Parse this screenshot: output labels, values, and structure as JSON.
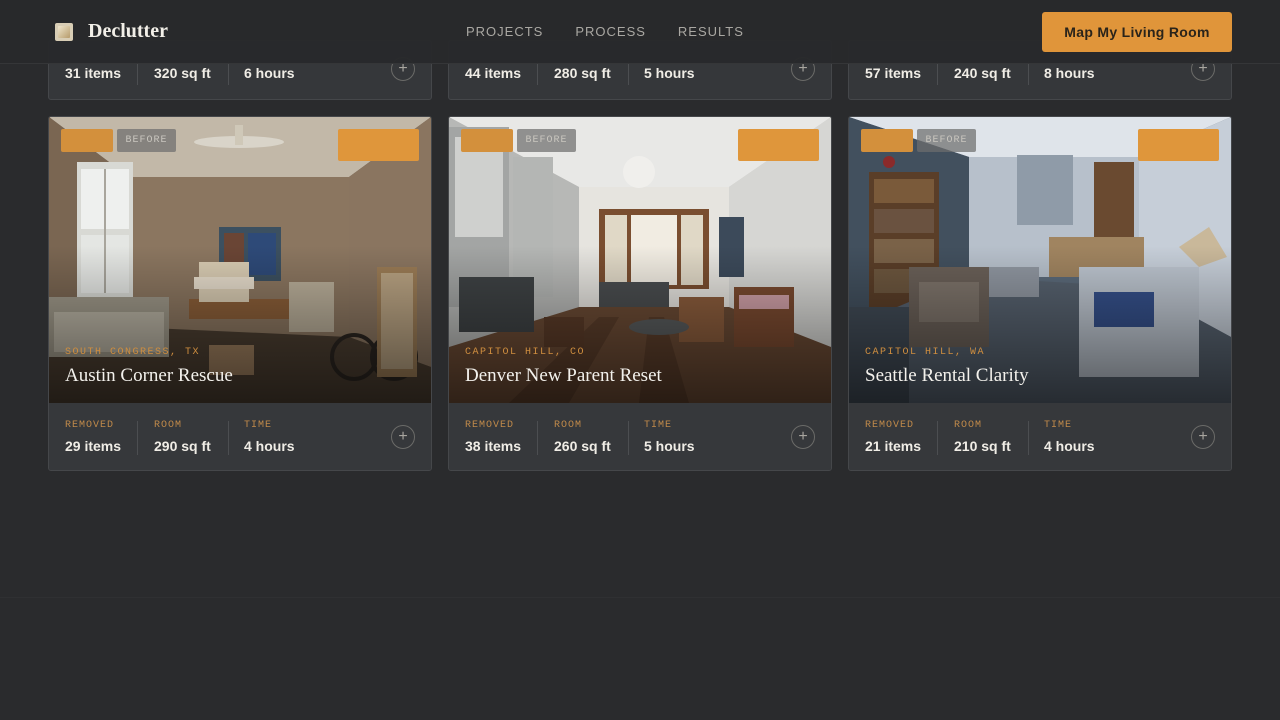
{
  "header": {
    "brand": "Declutter",
    "nav": [
      "PROJECTS",
      "PROCESS",
      "RESULTS"
    ],
    "cta_label": "Map My Living Room"
  },
  "top_cards": [
    {
      "removed": "31 items",
      "room": "320 sq ft",
      "time": "6 hours"
    },
    {
      "removed": "44 items",
      "room": "280 sq ft",
      "time": "5 hours"
    },
    {
      "removed": "57 items",
      "room": "240 sq ft",
      "time": "8 hours"
    }
  ],
  "cards": [
    {
      "badge": "BEFORE",
      "location": "SOUTH CONGRESS, TX",
      "title": "Austin Corner Rescue",
      "stat_labels": [
        "REMOVED",
        "ROOM",
        "TIME"
      ],
      "removed": "29 items",
      "room": "290 sq ft",
      "time": "4 hours"
    },
    {
      "badge": "BEFORE",
      "location": "CAPITOL HILL, CO",
      "title": "Denver New Parent Reset",
      "stat_labels": [
        "REMOVED",
        "ROOM",
        "TIME"
      ],
      "removed": "38 items",
      "room": "260 sq ft",
      "time": "5 hours"
    },
    {
      "badge": "BEFORE",
      "location": "CAPITOL HILL, WA",
      "title": "Seattle Rental Clarity",
      "stat_labels": [
        "REMOVED",
        "ROOM",
        "TIME"
      ],
      "removed": "21 items",
      "room": "210 sq ft",
      "time": "4 hours"
    }
  ],
  "icons": {
    "expand": "plus-circle-icon",
    "logo": "declutter-logo-icon"
  },
  "colors": {
    "accent": "#e0953a",
    "background": "#2a2b2d",
    "card": "#35373a"
  }
}
